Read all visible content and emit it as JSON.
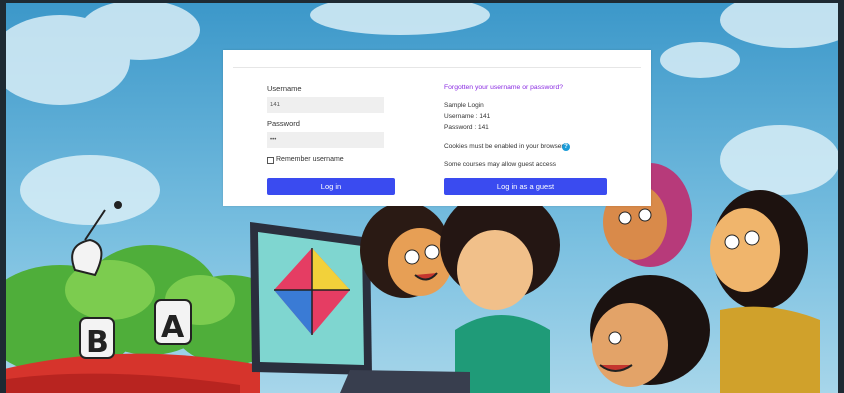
{
  "colors": {
    "accent": "#3a4bf0",
    "link": "#8a2be2",
    "help": "#1a9bd7"
  },
  "form": {
    "username_label": "Username",
    "username_value": "141",
    "password_label": "Password",
    "password_value": "•••",
    "remember_label": "Remember username",
    "login_button": "Log in"
  },
  "side": {
    "forgot_link": "Forgotten your username or password?",
    "sample_title": "Sample Login",
    "sample_username": "Username : 141",
    "sample_password": "Password : 141",
    "cookies_text": "Cookies must be enabled in your browser",
    "help_icon": "question-icon",
    "guest_text": "Some courses may allow guest access",
    "guest_button": "Log in as a guest"
  }
}
